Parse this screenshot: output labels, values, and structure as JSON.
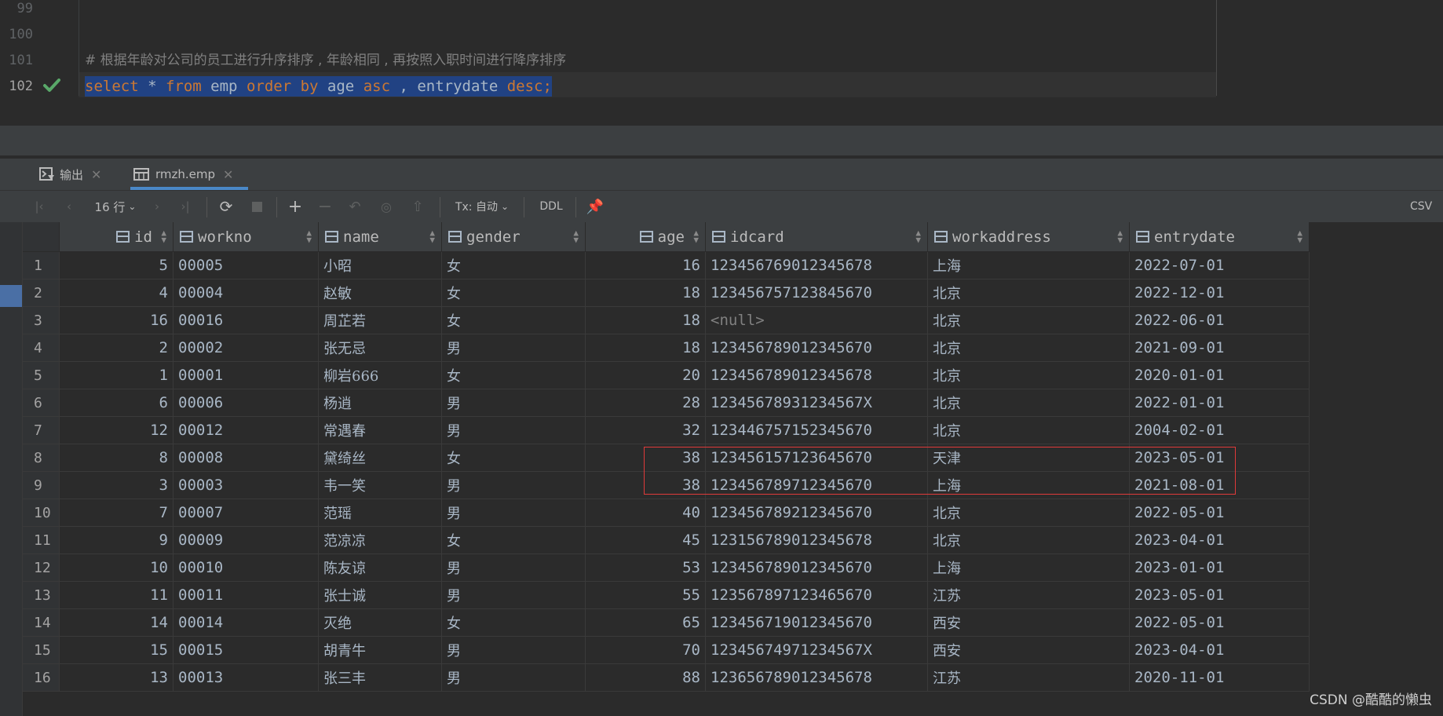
{
  "editor": {
    "lines": [
      {
        "num": "99",
        "text": ""
      },
      {
        "num": "100",
        "text": ""
      },
      {
        "num": "101",
        "text": "# 根据年龄对公司的员工进行升序排序 , 年龄相同 , 再按照入职时间进行降序排序"
      },
      {
        "num": "102",
        "text": ""
      }
    ],
    "sql_tokens": [
      "select",
      " * ",
      "from",
      " emp ",
      "order",
      " ",
      "by",
      " age ",
      "asc",
      " , entrydate ",
      "desc",
      ";"
    ]
  },
  "tabs": [
    {
      "label": "输出",
      "icon": "console-icon"
    },
    {
      "label": "rmzh.emp",
      "icon": "table-icon"
    }
  ],
  "toolbar": {
    "rows_label": "16 行",
    "tx_label": "Tx: 自动",
    "ddl_label": "DDL",
    "csv_label": "CSV"
  },
  "table": {
    "columns": [
      "id",
      "workno",
      "name",
      "gender",
      "age",
      "idcard",
      "workaddress",
      "entrydate"
    ],
    "rows": [
      [
        "1",
        "5",
        "00005",
        "小昭",
        "女",
        "16",
        "123456769012345678",
        "上海",
        "2022-07-01"
      ],
      [
        "2",
        "4",
        "00004",
        "赵敏",
        "女",
        "18",
        "123456757123845670",
        "北京",
        "2022-12-01"
      ],
      [
        "3",
        "16",
        "00016",
        "周芷若",
        "女",
        "18",
        "<null>",
        "北京",
        "2022-06-01"
      ],
      [
        "4",
        "2",
        "00002",
        "张无忌",
        "男",
        "18",
        "123456789012345670",
        "北京",
        "2021-09-01"
      ],
      [
        "5",
        "1",
        "00001",
        "柳岩666",
        "女",
        "20",
        "123456789012345678",
        "北京",
        "2020-01-01"
      ],
      [
        "6",
        "6",
        "00006",
        "杨逍",
        "男",
        "28",
        "12345678931234567X",
        "北京",
        "2022-01-01"
      ],
      [
        "7",
        "12",
        "00012",
        "常遇春",
        "男",
        "32",
        "123446757152345670",
        "北京",
        "2004-02-01"
      ],
      [
        "8",
        "8",
        "00008",
        "黛绮丝",
        "女",
        "38",
        "123456157123645670",
        "天津",
        "2023-05-01"
      ],
      [
        "9",
        "3",
        "00003",
        "韦一笑",
        "男",
        "38",
        "123456789712345670",
        "上海",
        "2021-08-01"
      ],
      [
        "10",
        "7",
        "00007",
        "范瑶",
        "男",
        "40",
        "123456789212345670",
        "北京",
        "2022-05-01"
      ],
      [
        "11",
        "9",
        "00009",
        "范凉凉",
        "女",
        "45",
        "123156789012345678",
        "北京",
        "2023-04-01"
      ],
      [
        "12",
        "10",
        "00010",
        "陈友谅",
        "男",
        "53",
        "123456789012345670",
        "上海",
        "2023-01-01"
      ],
      [
        "13",
        "11",
        "00011",
        "张士诚",
        "男",
        "55",
        "123567897123465670",
        "江苏",
        "2023-05-01"
      ],
      [
        "14",
        "14",
        "00014",
        "灭绝",
        "女",
        "65",
        "123456719012345670",
        "西安",
        "2022-05-01"
      ],
      [
        "15",
        "15",
        "00015",
        "胡青牛",
        "男",
        "70",
        "12345674971234567X",
        "西安",
        "2023-04-01"
      ],
      [
        "16",
        "13",
        "00013",
        "张三丰",
        "男",
        "88",
        "123656789012345678",
        "江苏",
        "2020-11-01"
      ]
    ]
  },
  "watermark": "CSDN @酷酷的懒虫",
  "colors": {
    "background": "#2b2b2b",
    "keyword": "#cc7832",
    "selection": "#214283",
    "highlight_box": "#e03a3a",
    "check": "#59a869"
  }
}
